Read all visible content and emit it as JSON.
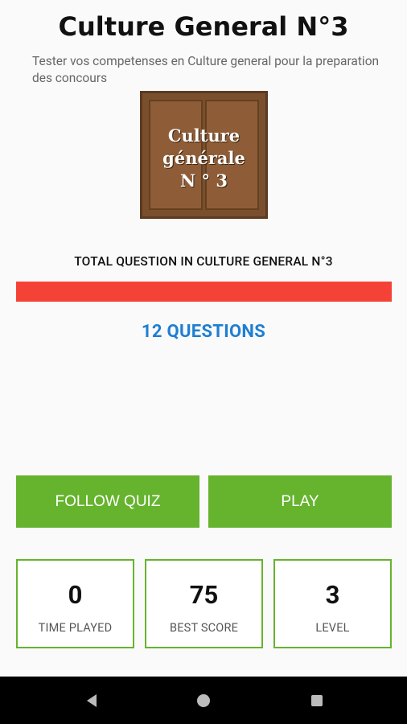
{
  "header": {
    "title": "Culture General N°3",
    "subtitle": "Tester vos competenses en Culture general pour la preparation des concours"
  },
  "logo": {
    "line1": "Culture",
    "line2": "générale",
    "line3": "N ° 3"
  },
  "progress": {
    "label": "TOTAL QUESTION IN CULTURE GENERAL N°3",
    "fraction": 1.0,
    "count_text": "12 QUESTIONS"
  },
  "actions": {
    "follow_label": "FOLLOW QUIZ",
    "play_label": "PLAY"
  },
  "stats": [
    {
      "value": "0",
      "label": "TIME PLAYED"
    },
    {
      "value": "75",
      "label": "BEST SCORE"
    },
    {
      "value": "3",
      "label": "LEVEL"
    }
  ],
  "colors": {
    "accent_green": "#66b32e",
    "progress_red": "#f44336",
    "count_blue": "#1f7fd1"
  },
  "nav_icons": [
    "back-icon",
    "home-icon",
    "recent-apps-icon"
  ]
}
